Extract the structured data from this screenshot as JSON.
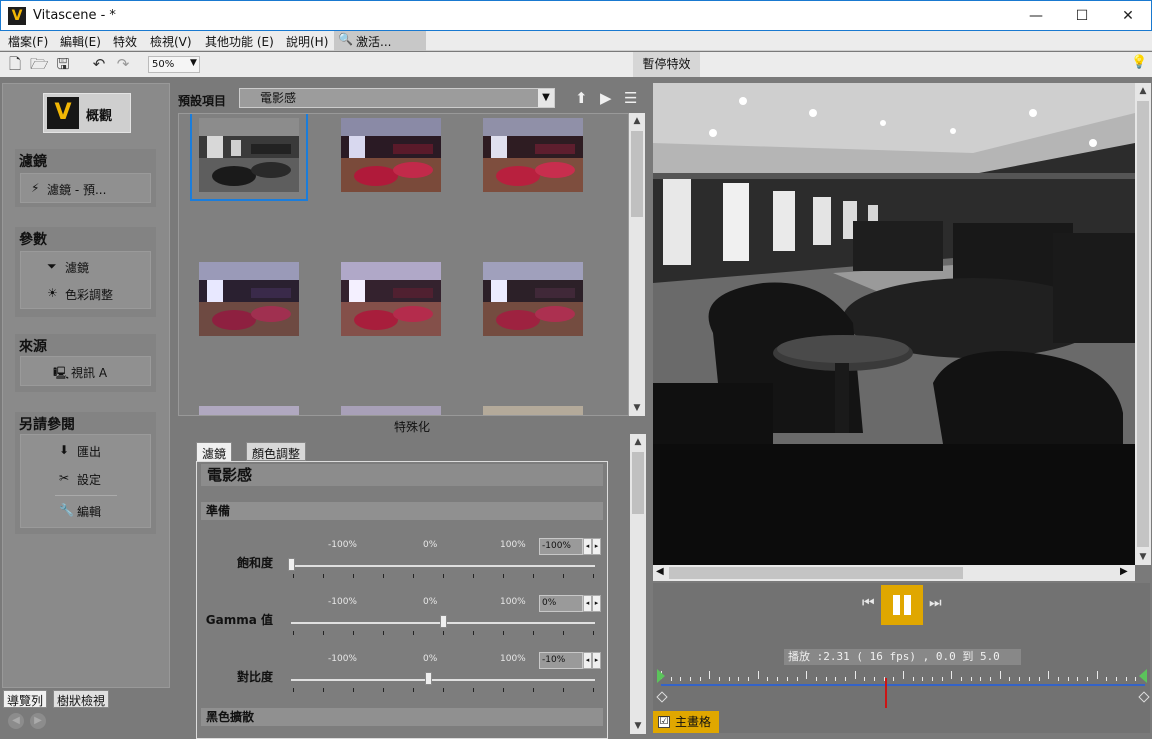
{
  "window": {
    "title": "Vitascene - *",
    "icon_letter": "V",
    "minimize": "—",
    "maximize": "☐",
    "close": "✕"
  },
  "menu": {
    "items": [
      "檔案(F)",
      "編輯(E)",
      "特效",
      "檢視(V)",
      "其他功能 (E)",
      "說明(H)"
    ],
    "search_label": "激活..."
  },
  "toolbar": {
    "zoom": "50%",
    "pause_effects": "暫停特效"
  },
  "sidebar": {
    "overview_label": "概觀",
    "sections": [
      {
        "title": "濾鏡",
        "items": [
          "濾鏡 - 預..."
        ]
      },
      {
        "title": "參數",
        "items": [
          "濾鏡",
          "色彩調整"
        ]
      },
      {
        "title": "來源",
        "items": [
          "視訊 A"
        ]
      },
      {
        "title": "另請參閱",
        "items": [
          "匯出",
          "設定",
          "編輯"
        ]
      }
    ],
    "bottom_tabs": [
      "導覽列",
      "樹狀檢視"
    ]
  },
  "presets": {
    "label": "預設項目",
    "selected": "電影感",
    "caption": "特殊化"
  },
  "params": {
    "tabs": [
      "濾鏡",
      "顏色調整"
    ],
    "title": "電影感",
    "group1": "準備",
    "group2": "黑色擴散",
    "scale": [
      "-100%",
      "0%",
      "100%"
    ],
    "sliders": [
      {
        "label": "飽和度",
        "value": "-100%",
        "level": -100
      },
      {
        "label": "Gamma 值",
        "value": "0%",
        "level": 0
      },
      {
        "label": "對比度",
        "value": "-10%",
        "level": -10
      }
    ]
  },
  "playback": {
    "status": "播放 :2.31 ( 16   fps) , 0.0 到 5.0",
    "playhead_seconds": 2.31,
    "range": [
      0.0,
      5.0
    ],
    "main_grid_label": "主畫格",
    "main_grid_checked": "☑"
  },
  "colors": {
    "accent": "#e0a700",
    "selection": "#1a7ddc",
    "timeline": "#3463c8",
    "playhead": "#cc1515"
  }
}
